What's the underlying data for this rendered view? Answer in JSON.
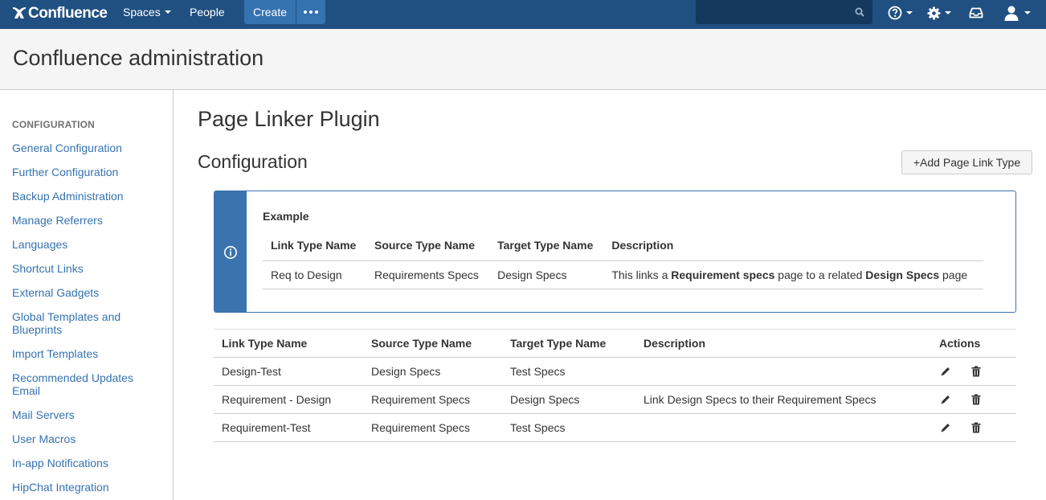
{
  "topbar": {
    "logo_text": "Confluence",
    "nav": {
      "spaces": "Spaces",
      "people": "People"
    },
    "create_label": "Create",
    "icons": [
      "more-icon",
      "search-icon",
      "help-icon",
      "gear-icon",
      "notifications-icon",
      "user-avatar-icon"
    ],
    "colors": {
      "bar": "#205081",
      "button": "#3572b0",
      "search": "#15395c"
    }
  },
  "admin_header": {
    "title": "Confluence administration"
  },
  "sidebar": {
    "heading": "CONFIGURATION",
    "items": [
      {
        "label": "General Configuration"
      },
      {
        "label": "Further Configuration"
      },
      {
        "label": "Backup Administration"
      },
      {
        "label": "Manage Referrers"
      },
      {
        "label": "Languages"
      },
      {
        "label": "Shortcut Links"
      },
      {
        "label": "External Gadgets"
      },
      {
        "label": "Global Templates and Blueprints"
      },
      {
        "label": "Import Templates"
      },
      {
        "label": "Recommended Updates Email"
      },
      {
        "label": "Mail Servers"
      },
      {
        "label": "User Macros"
      },
      {
        "label": "In-app Notifications"
      },
      {
        "label": "HipChat Integration"
      }
    ]
  },
  "main": {
    "page_title": "Page Linker Plugin",
    "section_title": "Configuration",
    "add_button": "+Add Page Link Type",
    "info": {
      "heading": "Example",
      "columns": [
        "Link Type Name",
        "Source Type Name",
        "Target Type Name",
        "Description"
      ],
      "row": {
        "name": "Req to Design",
        "source": "Requirements Specs",
        "target": "Design Specs",
        "desc_pre": "This links a ",
        "desc_b1": "Requirement specs",
        "desc_mid": " page to a related ",
        "desc_b2": "Design Specs",
        "desc_post": " page"
      }
    },
    "table": {
      "columns": [
        "Link Type Name",
        "Source Type Name",
        "Target Type Name",
        "Description",
        "Actions"
      ],
      "rows": [
        {
          "name": "Design-Test",
          "source": "Design Specs",
          "target": "Test Specs",
          "description": ""
        },
        {
          "name": "Requirement - Design",
          "source": "Requirement Specs",
          "target": "Design Specs",
          "description": "Link Design Specs to their Requirement Specs"
        },
        {
          "name": "Requirement-Test",
          "source": "Requirement Specs",
          "target": "Test Specs",
          "description": ""
        }
      ],
      "row_actions": [
        "edit-icon",
        "delete-icon"
      ]
    }
  }
}
